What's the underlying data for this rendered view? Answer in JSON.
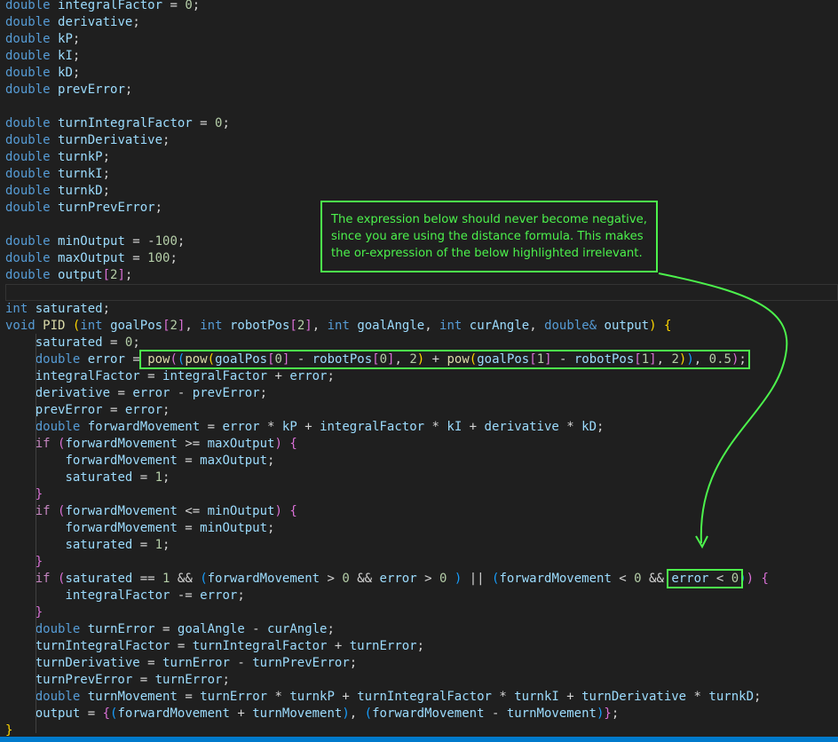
{
  "code_lines": [
    [
      [
        "kw",
        "double"
      ],
      [
        "op",
        " "
      ],
      [
        "var",
        "integralFactor"
      ],
      [
        "op",
        " = "
      ],
      [
        "num",
        "0"
      ],
      [
        "op",
        ";"
      ]
    ],
    [
      [
        "kw",
        "double"
      ],
      [
        "op",
        " "
      ],
      [
        "var",
        "derivative"
      ],
      [
        "op",
        ";"
      ]
    ],
    [
      [
        "kw",
        "double"
      ],
      [
        "op",
        " "
      ],
      [
        "var",
        "kP"
      ],
      [
        "op",
        ";"
      ]
    ],
    [
      [
        "kw",
        "double"
      ],
      [
        "op",
        " "
      ],
      [
        "var",
        "kI"
      ],
      [
        "op",
        ";"
      ]
    ],
    [
      [
        "kw",
        "double"
      ],
      [
        "op",
        " "
      ],
      [
        "var",
        "kD"
      ],
      [
        "op",
        ";"
      ]
    ],
    [
      [
        "kw",
        "double"
      ],
      [
        "op",
        " "
      ],
      [
        "var",
        "prevError"
      ],
      [
        "op",
        ";"
      ]
    ],
    [],
    [
      [
        "kw",
        "double"
      ],
      [
        "op",
        " "
      ],
      [
        "var",
        "turnIntegralFactor"
      ],
      [
        "op",
        " = "
      ],
      [
        "num",
        "0"
      ],
      [
        "op",
        ";"
      ]
    ],
    [
      [
        "kw",
        "double"
      ],
      [
        "op",
        " "
      ],
      [
        "var",
        "turnDerivative"
      ],
      [
        "op",
        ";"
      ]
    ],
    [
      [
        "kw",
        "double"
      ],
      [
        "op",
        " "
      ],
      [
        "var",
        "turnkP"
      ],
      [
        "op",
        ";"
      ]
    ],
    [
      [
        "kw",
        "double"
      ],
      [
        "op",
        " "
      ],
      [
        "var",
        "turnkI"
      ],
      [
        "op",
        ";"
      ]
    ],
    [
      [
        "kw",
        "double"
      ],
      [
        "op",
        " "
      ],
      [
        "var",
        "turnkD"
      ],
      [
        "op",
        ";"
      ]
    ],
    [
      [
        "kw",
        "double"
      ],
      [
        "op",
        " "
      ],
      [
        "var",
        "turnPrevError"
      ],
      [
        "op",
        ";"
      ]
    ],
    [],
    [
      [
        "kw",
        "double"
      ],
      [
        "op",
        " "
      ],
      [
        "var",
        "minOutput"
      ],
      [
        "op",
        " = -"
      ],
      [
        "num",
        "100"
      ],
      [
        "op",
        ";"
      ]
    ],
    [
      [
        "kw",
        "double"
      ],
      [
        "op",
        " "
      ],
      [
        "var",
        "maxOutput"
      ],
      [
        "op",
        " = "
      ],
      [
        "num",
        "100"
      ],
      [
        "op",
        ";"
      ]
    ],
    [
      [
        "kw",
        "double"
      ],
      [
        "op",
        " "
      ],
      [
        "var",
        "output"
      ],
      [
        "b2",
        "["
      ],
      [
        "num",
        "2"
      ],
      [
        "b2",
        "]"
      ],
      [
        "op",
        ";"
      ]
    ],
    [],
    [
      [
        "kw",
        "int"
      ],
      [
        "op",
        " "
      ],
      [
        "var",
        "saturated"
      ],
      [
        "op",
        ";"
      ]
    ],
    [
      [
        "kw",
        "void"
      ],
      [
        "op",
        " "
      ],
      [
        "fn",
        "PID"
      ],
      [
        "op",
        " "
      ],
      [
        "b1",
        "("
      ],
      [
        "kw",
        "int"
      ],
      [
        "op",
        " "
      ],
      [
        "var",
        "goalPos"
      ],
      [
        "b2",
        "["
      ],
      [
        "num",
        "2"
      ],
      [
        "b2",
        "]"
      ],
      [
        "op",
        ", "
      ],
      [
        "kw",
        "int"
      ],
      [
        "op",
        " "
      ],
      [
        "var",
        "robotPos"
      ],
      [
        "b2",
        "["
      ],
      [
        "num",
        "2"
      ],
      [
        "b2",
        "]"
      ],
      [
        "op",
        ", "
      ],
      [
        "kw",
        "int"
      ],
      [
        "op",
        " "
      ],
      [
        "var",
        "goalAngle"
      ],
      [
        "op",
        ", "
      ],
      [
        "kw",
        "int"
      ],
      [
        "op",
        " "
      ],
      [
        "var",
        "curAngle"
      ],
      [
        "op",
        ", "
      ],
      [
        "kw",
        "double&"
      ],
      [
        "op",
        " "
      ],
      [
        "var",
        "output"
      ],
      [
        "b1",
        ")"
      ],
      [
        "op",
        " "
      ],
      [
        "b1",
        "{"
      ]
    ],
    [
      [
        "op",
        "    "
      ],
      [
        "var",
        "saturated"
      ],
      [
        "op",
        " = "
      ],
      [
        "num",
        "0"
      ],
      [
        "op",
        ";"
      ]
    ],
    [
      [
        "op",
        "    "
      ],
      [
        "kw",
        "double"
      ],
      [
        "op",
        " "
      ],
      [
        "var",
        "error"
      ],
      [
        "op",
        " = "
      ],
      [
        "fn",
        "pow"
      ],
      [
        "b2",
        "("
      ],
      [
        "b3",
        "("
      ],
      [
        "fn",
        "pow"
      ],
      [
        "b1",
        "("
      ],
      [
        "var",
        "goalPos"
      ],
      [
        "b2",
        "["
      ],
      [
        "num",
        "0"
      ],
      [
        "b2",
        "]"
      ],
      [
        "op",
        " - "
      ],
      [
        "var",
        "robotPos"
      ],
      [
        "b2",
        "["
      ],
      [
        "num",
        "0"
      ],
      [
        "b2",
        "]"
      ],
      [
        "op",
        ", "
      ],
      [
        "num",
        "2"
      ],
      [
        "b1",
        ")"
      ],
      [
        "op",
        " + "
      ],
      [
        "fn",
        "pow"
      ],
      [
        "b1",
        "("
      ],
      [
        "var",
        "goalPos"
      ],
      [
        "b2",
        "["
      ],
      [
        "num",
        "1"
      ],
      [
        "b2",
        "]"
      ],
      [
        "op",
        " - "
      ],
      [
        "var",
        "robotPos"
      ],
      [
        "b2",
        "["
      ],
      [
        "num",
        "1"
      ],
      [
        "b2",
        "]"
      ],
      [
        "op",
        ", "
      ],
      [
        "num",
        "2"
      ],
      [
        "b1",
        ")"
      ],
      [
        "b3",
        ")"
      ],
      [
        "op",
        ", "
      ],
      [
        "num",
        "0.5"
      ],
      [
        "b2",
        ")"
      ],
      [
        "op",
        ";"
      ]
    ],
    [
      [
        "op",
        "    "
      ],
      [
        "var",
        "integralFactor"
      ],
      [
        "op",
        " = "
      ],
      [
        "var",
        "integralFactor"
      ],
      [
        "op",
        " + "
      ],
      [
        "var",
        "error"
      ],
      [
        "op",
        ";"
      ]
    ],
    [
      [
        "op",
        "    "
      ],
      [
        "var",
        "derivative"
      ],
      [
        "op",
        " = "
      ],
      [
        "var",
        "error"
      ],
      [
        "op",
        " - "
      ],
      [
        "var",
        "prevError"
      ],
      [
        "op",
        ";"
      ]
    ],
    [
      [
        "op",
        "    "
      ],
      [
        "var",
        "prevError"
      ],
      [
        "op",
        " = "
      ],
      [
        "var",
        "error"
      ],
      [
        "op",
        ";"
      ]
    ],
    [
      [
        "op",
        "    "
      ],
      [
        "kw",
        "double"
      ],
      [
        "op",
        " "
      ],
      [
        "var",
        "forwardMovement"
      ],
      [
        "op",
        " = "
      ],
      [
        "var",
        "error"
      ],
      [
        "op",
        " * "
      ],
      [
        "var",
        "kP"
      ],
      [
        "op",
        " + "
      ],
      [
        "var",
        "integralFactor"
      ],
      [
        "op",
        " * "
      ],
      [
        "var",
        "kI"
      ],
      [
        "op",
        " + "
      ],
      [
        "var",
        "derivative"
      ],
      [
        "op",
        " * "
      ],
      [
        "var",
        "kD"
      ],
      [
        "op",
        ";"
      ]
    ],
    [
      [
        "op",
        "    "
      ],
      [
        "ctl",
        "if"
      ],
      [
        "op",
        " "
      ],
      [
        "b2",
        "("
      ],
      [
        "var",
        "forwardMovement"
      ],
      [
        "op",
        " >= "
      ],
      [
        "var",
        "maxOutput"
      ],
      [
        "b2",
        ")"
      ],
      [
        "op",
        " "
      ],
      [
        "b2",
        "{"
      ]
    ],
    [
      [
        "op",
        "        "
      ],
      [
        "var",
        "forwardMovement"
      ],
      [
        "op",
        " = "
      ],
      [
        "var",
        "maxOutput"
      ],
      [
        "op",
        ";"
      ]
    ],
    [
      [
        "op",
        "        "
      ],
      [
        "var",
        "saturated"
      ],
      [
        "op",
        " = "
      ],
      [
        "num",
        "1"
      ],
      [
        "op",
        ";"
      ]
    ],
    [
      [
        "op",
        "    "
      ],
      [
        "b2",
        "}"
      ]
    ],
    [
      [
        "op",
        "    "
      ],
      [
        "ctl",
        "if"
      ],
      [
        "op",
        " "
      ],
      [
        "b2",
        "("
      ],
      [
        "var",
        "forwardMovement"
      ],
      [
        "op",
        " <= "
      ],
      [
        "var",
        "minOutput"
      ],
      [
        "b2",
        ")"
      ],
      [
        "op",
        " "
      ],
      [
        "b2",
        "{"
      ]
    ],
    [
      [
        "op",
        "        "
      ],
      [
        "var",
        "forwardMovement"
      ],
      [
        "op",
        " = "
      ],
      [
        "var",
        "minOutput"
      ],
      [
        "op",
        ";"
      ]
    ],
    [
      [
        "op",
        "        "
      ],
      [
        "var",
        "saturated"
      ],
      [
        "op",
        " = "
      ],
      [
        "num",
        "1"
      ],
      [
        "op",
        ";"
      ]
    ],
    [
      [
        "op",
        "    "
      ],
      [
        "b2",
        "}"
      ]
    ],
    [
      [
        "op",
        "    "
      ],
      [
        "ctl",
        "if"
      ],
      [
        "op",
        " "
      ],
      [
        "b2",
        "("
      ],
      [
        "var",
        "saturated"
      ],
      [
        "op",
        " == "
      ],
      [
        "num",
        "1"
      ],
      [
        "op",
        " && "
      ],
      [
        "b3",
        "("
      ],
      [
        "var",
        "forwardMovement"
      ],
      [
        "op",
        " > "
      ],
      [
        "num",
        "0"
      ],
      [
        "op",
        " && "
      ],
      [
        "var",
        "error"
      ],
      [
        "op",
        " > "
      ],
      [
        "num",
        "0"
      ],
      [
        "op",
        " "
      ],
      [
        "b3",
        ")"
      ],
      [
        "op",
        " || "
      ],
      [
        "b3",
        "("
      ],
      [
        "var",
        "forwardMovement"
      ],
      [
        "op",
        " < "
      ],
      [
        "num",
        "0"
      ],
      [
        "op",
        " && "
      ],
      [
        "var",
        "error"
      ],
      [
        "op",
        " < "
      ],
      [
        "num",
        "0"
      ],
      [
        "b3",
        ")"
      ],
      [
        "b2",
        ")"
      ],
      [
        "op",
        " "
      ],
      [
        "b2",
        "{"
      ]
    ],
    [
      [
        "op",
        "        "
      ],
      [
        "var",
        "integralFactor"
      ],
      [
        "op",
        " -= "
      ],
      [
        "var",
        "error"
      ],
      [
        "op",
        ";"
      ]
    ],
    [
      [
        "op",
        "    "
      ],
      [
        "b2",
        "}"
      ]
    ],
    [
      [
        "op",
        "    "
      ],
      [
        "kw",
        "double"
      ],
      [
        "op",
        " "
      ],
      [
        "var",
        "turnError"
      ],
      [
        "op",
        " = "
      ],
      [
        "var",
        "goalAngle"
      ],
      [
        "op",
        " - "
      ],
      [
        "var",
        "curAngle"
      ],
      [
        "op",
        ";"
      ]
    ],
    [
      [
        "op",
        "    "
      ],
      [
        "var",
        "turnIntegralFactor"
      ],
      [
        "op",
        " = "
      ],
      [
        "var",
        "turnIntegralFactor"
      ],
      [
        "op",
        " + "
      ],
      [
        "var",
        "turnError"
      ],
      [
        "op",
        ";"
      ]
    ],
    [
      [
        "op",
        "    "
      ],
      [
        "var",
        "turnDerivative"
      ],
      [
        "op",
        " = "
      ],
      [
        "var",
        "turnError"
      ],
      [
        "op",
        " - "
      ],
      [
        "var",
        "turnPrevError"
      ],
      [
        "op",
        ";"
      ]
    ],
    [
      [
        "op",
        "    "
      ],
      [
        "var",
        "turnPrevError"
      ],
      [
        "op",
        " = "
      ],
      [
        "var",
        "turnError"
      ],
      [
        "op",
        ";"
      ]
    ],
    [
      [
        "op",
        "    "
      ],
      [
        "kw",
        "double"
      ],
      [
        "op",
        " "
      ],
      [
        "var",
        "turnMovement"
      ],
      [
        "op",
        " = "
      ],
      [
        "var",
        "turnError"
      ],
      [
        "op",
        " * "
      ],
      [
        "var",
        "turnkP"
      ],
      [
        "op",
        " + "
      ],
      [
        "var",
        "turnIntegralFactor"
      ],
      [
        "op",
        " * "
      ],
      [
        "var",
        "turnkI"
      ],
      [
        "op",
        " + "
      ],
      [
        "var",
        "turnDerivative"
      ],
      [
        "op",
        " * "
      ],
      [
        "var",
        "turnkD"
      ],
      [
        "op",
        ";"
      ]
    ],
    [
      [
        "op",
        "    "
      ],
      [
        "var",
        "output"
      ],
      [
        "op",
        " = "
      ],
      [
        "b2",
        "{"
      ],
      [
        "b3",
        "("
      ],
      [
        "var",
        "forwardMovement"
      ],
      [
        "op",
        " + "
      ],
      [
        "var",
        "turnMovement"
      ],
      [
        "b3",
        ")"
      ],
      [
        "op",
        ", "
      ],
      [
        "b3",
        "("
      ],
      [
        "var",
        "forwardMovement"
      ],
      [
        "op",
        " - "
      ],
      [
        "var",
        "turnMovement"
      ],
      [
        "b3",
        ")"
      ],
      [
        "b2",
        "}"
      ],
      [
        "op",
        ";"
      ]
    ],
    [
      [
        "b1",
        "}"
      ]
    ]
  ],
  "annotation": {
    "text": "The expression below should never become negative, since you are using the distance formula. This makes the or-expression of the below highlighted irrelevant."
  },
  "colors": {
    "annotation": "#4cf24c",
    "background": "#1f1f1f",
    "status_bar": "#007acc"
  }
}
